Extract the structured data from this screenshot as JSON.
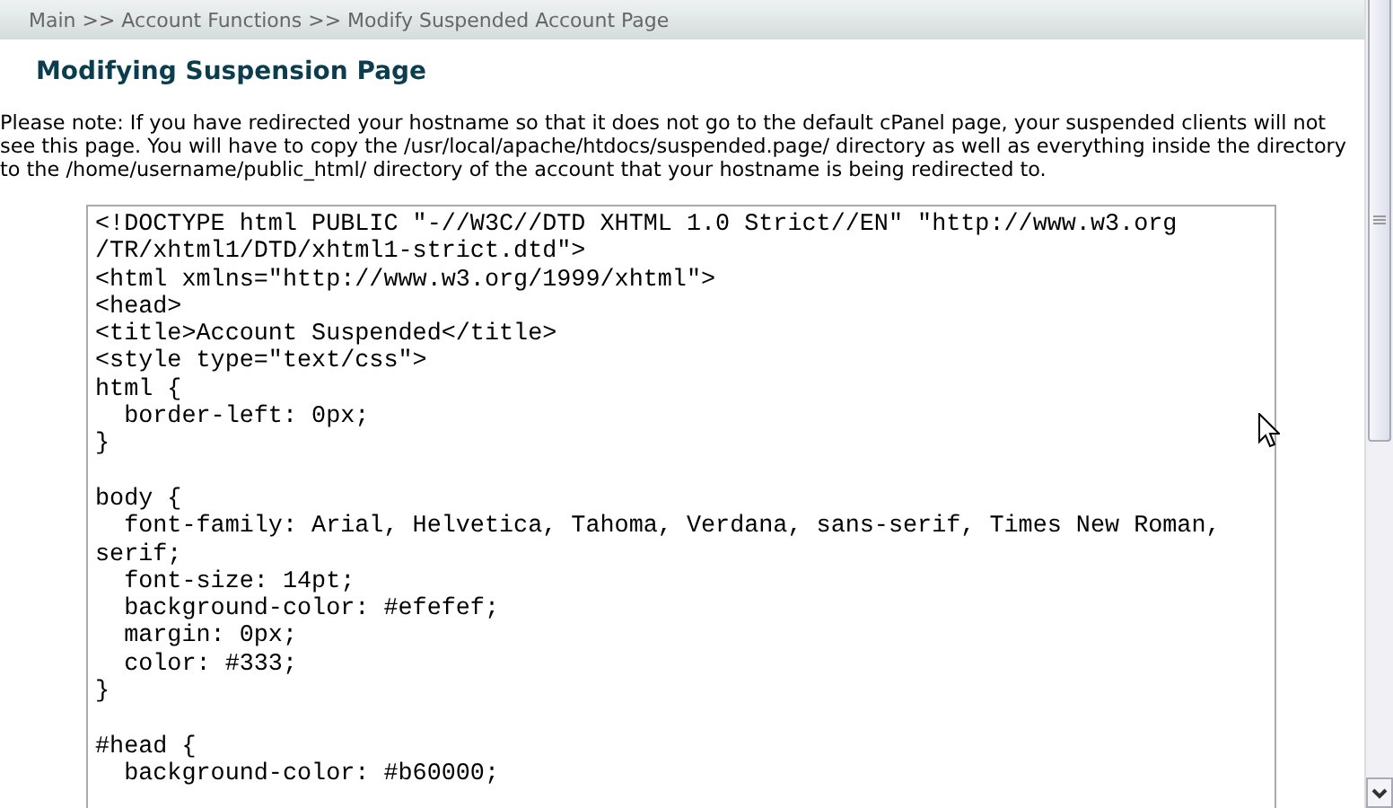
{
  "breadcrumb": "Main >> Account Functions >> Modify Suspended Account Page",
  "title": "Modifying Suspension Page",
  "note": "Please note: If you have redirected your hostname so that it does not go to the default cPanel page, your suspended clients will not see this page. You will have to copy the /usr/local/apache/htdocs/suspended.page/ directory as well as everything inside the directory to the /home/username/public_html/ directory of the account that your hostname is being redirected to.",
  "editor": {
    "lines": [
      "<!DOCTYPE html PUBLIC \"-//W3C//DTD XHTML 1.0 Strict//EN\" \"http://www.w3.org",
      "/TR/xhtml1/DTD/xhtml1-strict.dtd\">",
      "<html xmlns=\"http://www.w3.org/1999/xhtml\">",
      "<head>",
      "<title>Account Suspended</title>",
      "<style type=\"text/css\">",
      "html {",
      "  border-left: 0px;",
      "}",
      {
        "blank_before": true,
        "text": "body {"
      },
      "  font-family: Arial, Helvetica, Tahoma, Verdana, sans-serif, Times New Roman,",
      "serif;",
      "  font-size: 14pt;",
      "  background-color: #efefef;",
      "  margin: 0px;",
      "  color: #333;",
      "}",
      {
        "blank_before": true,
        "text": "#head {"
      },
      "  background-color: #b60000;"
    ]
  }
}
